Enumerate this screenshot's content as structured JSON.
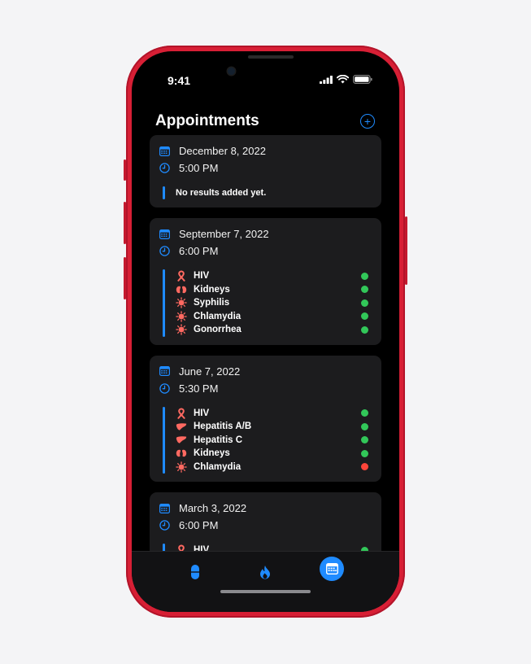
{
  "status": {
    "time": "9:41"
  },
  "header": {
    "title": "Appointments"
  },
  "colors": {
    "accent": "#1f8bff",
    "positive": "#32c759",
    "negative": "#ff453a",
    "icon_red": "#ff6961",
    "card": "#1c1c1e"
  },
  "appointments": [
    {
      "date": "December 8, 2022",
      "time": "5:00 PM",
      "empty_text": "No results added yet.",
      "results": []
    },
    {
      "date": "September 7, 2022",
      "time": "6:00 PM",
      "results": [
        {
          "name": "HIV",
          "icon": "ribbon-icon",
          "status": "positive"
        },
        {
          "name": "Kidneys",
          "icon": "kidneys-icon",
          "status": "positive"
        },
        {
          "name": "Syphilis",
          "icon": "virus-icon",
          "status": "positive"
        },
        {
          "name": "Chlamydia",
          "icon": "virus-icon",
          "status": "positive"
        },
        {
          "name": "Gonorrhea",
          "icon": "virus-icon",
          "status": "positive"
        }
      ]
    },
    {
      "date": "June 7, 2022",
      "time": "5:30 PM",
      "results": [
        {
          "name": "HIV",
          "icon": "ribbon-icon",
          "status": "positive"
        },
        {
          "name": "Hepatitis A/B",
          "icon": "liver-icon",
          "status": "positive"
        },
        {
          "name": "Hepatitis C",
          "icon": "liver-icon",
          "status": "positive"
        },
        {
          "name": "Kidneys",
          "icon": "kidneys-icon",
          "status": "positive"
        },
        {
          "name": "Chlamydia",
          "icon": "virus-icon",
          "status": "negative"
        }
      ]
    },
    {
      "date": "March 3, 2022",
      "time": "6:00 PM",
      "results": [
        {
          "name": "HIV",
          "icon": "ribbon-icon",
          "status": "positive"
        }
      ]
    }
  ],
  "tabs": [
    {
      "name": "tab-medications",
      "icon": "pill-icon",
      "selected": false
    },
    {
      "name": "tab-streak",
      "icon": "flame-icon",
      "selected": false
    },
    {
      "name": "tab-appointments",
      "icon": "calendar-icon",
      "selected": true
    }
  ]
}
